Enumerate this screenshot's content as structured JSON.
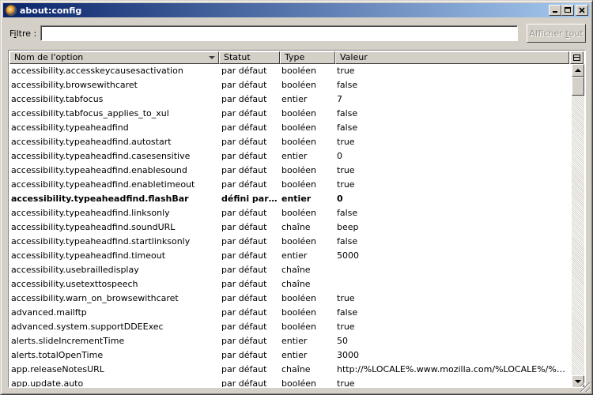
{
  "window": {
    "title": "about:config"
  },
  "filter": {
    "label_prefix": "F",
    "label_accel": "i",
    "label_suffix": "ltre :",
    "value": "",
    "button_label_prefix": "Afficher ",
    "button_label_accel": "t",
    "button_label_suffix": "out"
  },
  "columns": {
    "name": "Nom de l'option",
    "status": "Statut",
    "type": "Type",
    "value": "Valeur"
  },
  "rows": [
    {
      "name": "accessibility.accesskeycausesactivation",
      "status": "par défaut",
      "type": "booléen",
      "value": "true"
    },
    {
      "name": "accessibility.browsewithcaret",
      "status": "par défaut",
      "type": "booléen",
      "value": "false"
    },
    {
      "name": "accessibility.tabfocus",
      "status": "par défaut",
      "type": "entier",
      "value": "7"
    },
    {
      "name": "accessibility.tabfocus_applies_to_xul",
      "status": "par défaut",
      "type": "booléen",
      "value": "false"
    },
    {
      "name": "accessibility.typeaheadfind",
      "status": "par défaut",
      "type": "booléen",
      "value": "false"
    },
    {
      "name": "accessibility.typeaheadfind.autostart",
      "status": "par défaut",
      "type": "booléen",
      "value": "true"
    },
    {
      "name": "accessibility.typeaheadfind.casesensitive",
      "status": "par défaut",
      "type": "entier",
      "value": "0"
    },
    {
      "name": "accessibility.typeaheadfind.enablesound",
      "status": "par défaut",
      "type": "booléen",
      "value": "true"
    },
    {
      "name": "accessibility.typeaheadfind.enabletimeout",
      "status": "par défaut",
      "type": "booléen",
      "value": "true"
    },
    {
      "name": "accessibility.typeaheadfind.flashBar",
      "status": "défini par l'...",
      "type": "entier",
      "value": "0",
      "bold": true
    },
    {
      "name": "accessibility.typeaheadfind.linksonly",
      "status": "par défaut",
      "type": "booléen",
      "value": "false"
    },
    {
      "name": "accessibility.typeaheadfind.soundURL",
      "status": "par défaut",
      "type": "chaîne",
      "value": "beep"
    },
    {
      "name": "accessibility.typeaheadfind.startlinksonly",
      "status": "par défaut",
      "type": "booléen",
      "value": "false"
    },
    {
      "name": "accessibility.typeaheadfind.timeout",
      "status": "par défaut",
      "type": "entier",
      "value": "5000"
    },
    {
      "name": "accessibility.usebrailledisplay",
      "status": "par défaut",
      "type": "chaîne",
      "value": ""
    },
    {
      "name": "accessibility.usetexttospeech",
      "status": "par défaut",
      "type": "chaîne",
      "value": ""
    },
    {
      "name": "accessibility.warn_on_browsewithcaret",
      "status": "par défaut",
      "type": "booléen",
      "value": "true"
    },
    {
      "name": "advanced.mailftp",
      "status": "par défaut",
      "type": "booléen",
      "value": "false"
    },
    {
      "name": "advanced.system.supportDDEExec",
      "status": "par défaut",
      "type": "booléen",
      "value": "true"
    },
    {
      "name": "alerts.slideIncrementTime",
      "status": "par défaut",
      "type": "entier",
      "value": "50"
    },
    {
      "name": "alerts.totalOpenTime",
      "status": "par défaut",
      "type": "entier",
      "value": "3000"
    },
    {
      "name": "app.releaseNotesURL",
      "status": "par défaut",
      "type": "chaîne",
      "value": "http://%LOCALE%.www.mozilla.com/%LOCALE%/%APP..."
    },
    {
      "name": "app.update.auto",
      "status": "par défaut",
      "type": "booléen",
      "value": "true"
    }
  ]
}
